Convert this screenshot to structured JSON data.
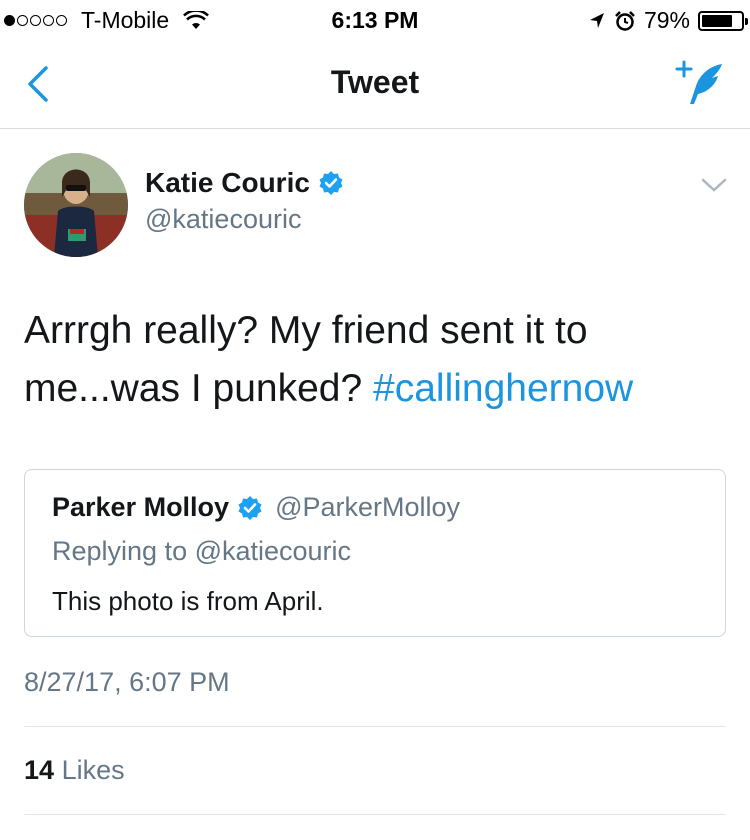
{
  "status_bar": {
    "carrier": "T-Mobile",
    "time": "6:13 PM",
    "battery": "79%",
    "battery_level": 0.79,
    "signal_bars_filled": 1,
    "signal_bars_total": 5
  },
  "nav": {
    "title": "Tweet",
    "back_icon": "chevron-left-icon",
    "compose_icon": "compose-quill-icon"
  },
  "tweet": {
    "author_name": "Katie Couric",
    "author_handle": "@katiecouric",
    "text": "Arrrgh really? My friend sent it to me...was I punked? ",
    "hashtag": "#callinghernow",
    "timestamp": "8/27/17, 6:07 PM",
    "likes_count": "14",
    "likes_label": "Likes"
  },
  "quoted_tweet": {
    "author_name": "Parker Molloy",
    "author_handle": "@ParkerMolloy",
    "replying_to": "Replying to @katiecouric",
    "text": "This photo is from April."
  },
  "colors": {
    "accent": "#1b95e0",
    "secondary_text": "#657786",
    "verified": "#1da1f2"
  }
}
